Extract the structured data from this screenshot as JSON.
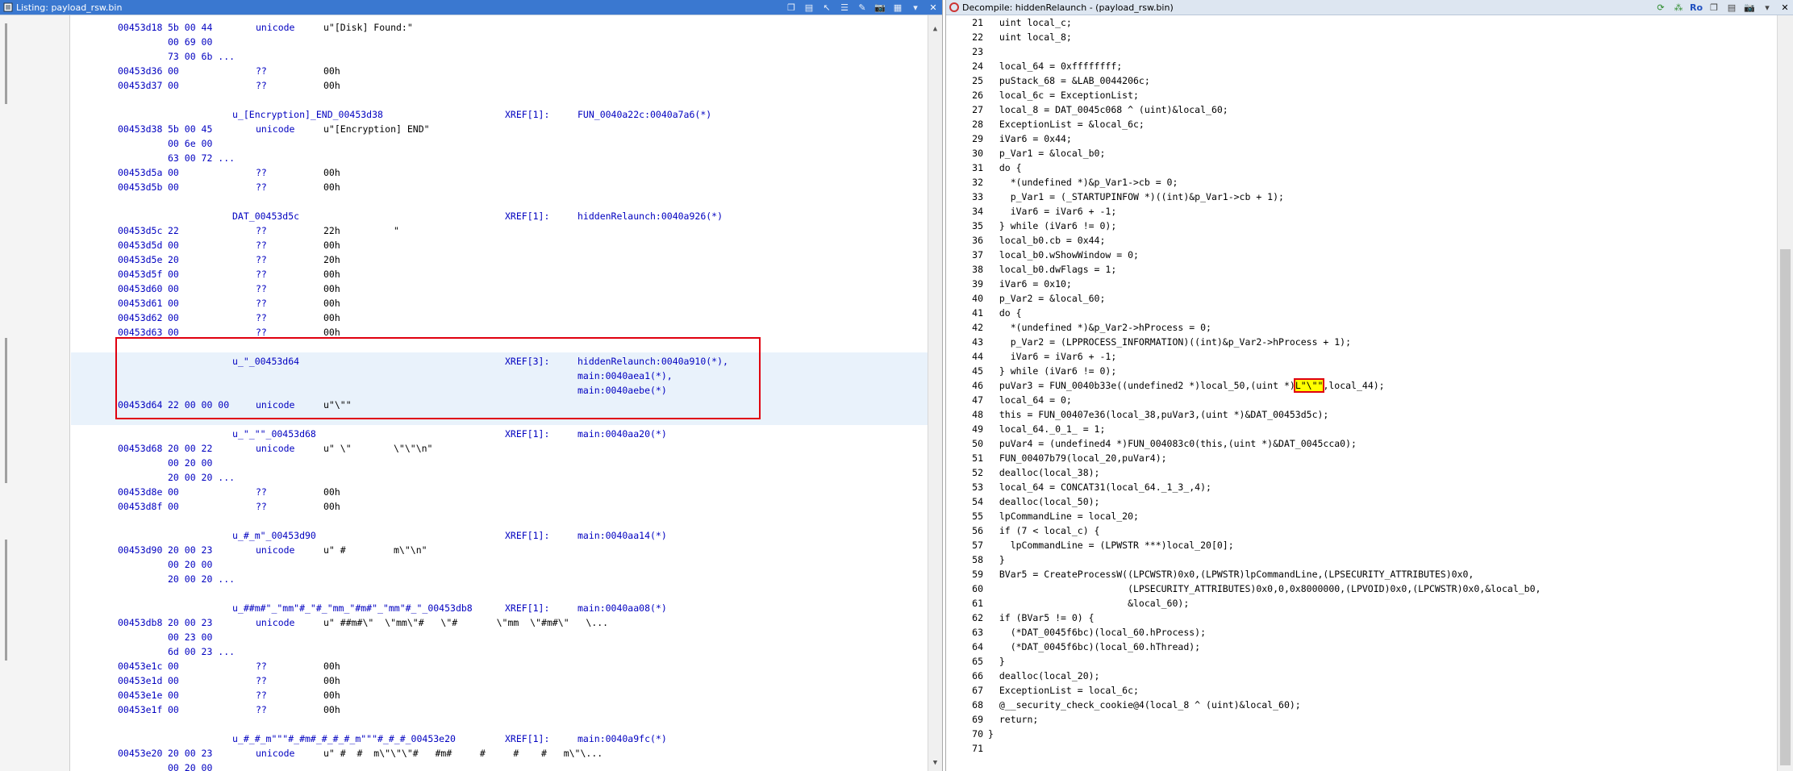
{
  "left": {
    "title": "Listing:  payload_rsw.bin",
    "rows": [
      {
        "type": "data",
        "addr": "00453d18",
        "bytes": "5b 00 44",
        "mnem": "unicode",
        "oper": "u\"[Disk] Found:\""
      },
      {
        "type": "cont",
        "bytes": "00 69 00"
      },
      {
        "type": "cont",
        "bytes": "73 00 6b ..."
      },
      {
        "type": "data",
        "addr": "00453d36",
        "bytes": "00",
        "mnem": "??",
        "oper": "00h"
      },
      {
        "type": "data",
        "addr": "00453d37",
        "bytes": "00",
        "mnem": "??",
        "oper": "00h"
      },
      {
        "type": "blank"
      },
      {
        "type": "label",
        "label": "u_[Encryption]_END_00453d38",
        "xref": "XREF[1]:",
        "xref_t": "FUN_0040a22c:0040a7a6(*)"
      },
      {
        "type": "data",
        "addr": "00453d38",
        "bytes": "5b 00 45",
        "mnem": "unicode",
        "oper": "u\"[Encryption] END\""
      },
      {
        "type": "cont",
        "bytes": "00 6e 00"
      },
      {
        "type": "cont",
        "bytes": "63 00 72 ..."
      },
      {
        "type": "data",
        "addr": "00453d5a",
        "bytes": "00",
        "mnem": "??",
        "oper": "00h"
      },
      {
        "type": "data",
        "addr": "00453d5b",
        "bytes": "00",
        "mnem": "??",
        "oper": "00h"
      },
      {
        "type": "blank"
      },
      {
        "type": "label",
        "label": "DAT_00453d5c",
        "xref": "XREF[1]:",
        "xref_t": "hiddenRelaunch:0040a926(*)"
      },
      {
        "type": "data",
        "addr": "00453d5c",
        "bytes": "22",
        "mnem": "??",
        "oper": "22h",
        "cmt": "\""
      },
      {
        "type": "data",
        "addr": "00453d5d",
        "bytes": "00",
        "mnem": "??",
        "oper": "00h"
      },
      {
        "type": "data",
        "addr": "00453d5e",
        "bytes": "20",
        "mnem": "??",
        "oper": "20h"
      },
      {
        "type": "data",
        "addr": "00453d5f",
        "bytes": "00",
        "mnem": "??",
        "oper": "00h"
      },
      {
        "type": "data",
        "addr": "00453d60",
        "bytes": "00",
        "mnem": "??",
        "oper": "00h"
      },
      {
        "type": "data",
        "addr": "00453d61",
        "bytes": "00",
        "mnem": "??",
        "oper": "00h"
      },
      {
        "type": "data",
        "addr": "00453d62",
        "bytes": "00",
        "mnem": "??",
        "oper": "00h"
      },
      {
        "type": "data",
        "addr": "00453d63",
        "bytes": "00",
        "mnem": "??",
        "oper": "00h"
      },
      {
        "type": "blank"
      },
      {
        "type": "label",
        "label": "u_\"_00453d64",
        "xref": "XREF[3]:",
        "xref_t": "hiddenRelaunch:0040a910(*),"
      },
      {
        "type": "xrefcont",
        "xref_t": "main:0040aea1(*),"
      },
      {
        "type": "xrefcont",
        "xref_t": "main:0040aebe(*)"
      },
      {
        "type": "data",
        "addr": "00453d64",
        "bytes": "22 00 00 00",
        "mnem": "unicode",
        "oper": "u\"\\\"\""
      },
      {
        "type": "blank"
      },
      {
        "type": "label",
        "label": "u_\"_\"\"_00453d68",
        "xref": "XREF[1]:",
        "xref_t": "main:0040aa20(*)"
      },
      {
        "type": "data",
        "addr": "00453d68",
        "bytes": "20 00 22",
        "mnem": "unicode",
        "oper": "u\" \\\"",
        "cmt": "\\\"\\\"\\n\""
      },
      {
        "type": "cont",
        "bytes": "00 20 00"
      },
      {
        "type": "cont",
        "bytes": "20 00 20 ..."
      },
      {
        "type": "data",
        "addr": "00453d8e",
        "bytes": "00",
        "mnem": "??",
        "oper": "00h"
      },
      {
        "type": "data",
        "addr": "00453d8f",
        "bytes": "00",
        "mnem": "??",
        "oper": "00h"
      },
      {
        "type": "blank"
      },
      {
        "type": "label",
        "label": "u_#_m\"_00453d90",
        "xref": "XREF[1]:",
        "xref_t": "main:0040aa14(*)"
      },
      {
        "type": "data",
        "addr": "00453d90",
        "bytes": "20 00 23",
        "mnem": "unicode",
        "oper": "u\" #",
        "cmt": "m\\\"\\n\""
      },
      {
        "type": "cont",
        "bytes": "00 20 00"
      },
      {
        "type": "cont",
        "bytes": "20 00 20 ..."
      },
      {
        "type": "blank"
      },
      {
        "type": "label",
        "label": "u_##m#\"_\"mm\"#_\"#_\"mm_\"#m#\"_\"mm\"#_\"_00453db8",
        "xref": "XREF[1]:",
        "xref_t": "main:0040aa08(*)"
      },
      {
        "type": "data",
        "addr": "00453db8",
        "bytes": "20 00 23",
        "mnem": "unicode",
        "oper": "u\" ##m#\\\"  \\\"mm\\\"#   \\\"#       \\\"mm  \\\"#m#\\\"   \\..."
      },
      {
        "type": "cont",
        "bytes": "00 23 00"
      },
      {
        "type": "cont",
        "bytes": "6d 00 23 ..."
      },
      {
        "type": "data",
        "addr": "00453e1c",
        "bytes": "00",
        "mnem": "??",
        "oper": "00h"
      },
      {
        "type": "data",
        "addr": "00453e1d",
        "bytes": "00",
        "mnem": "??",
        "oper": "00h"
      },
      {
        "type": "data",
        "addr": "00453e1e",
        "bytes": "00",
        "mnem": "??",
        "oper": "00h"
      },
      {
        "type": "data",
        "addr": "00453e1f",
        "bytes": "00",
        "mnem": "??",
        "oper": "00h"
      },
      {
        "type": "blank"
      },
      {
        "type": "label",
        "label": "u_#_#_m\"\"\"#_#m#_#_#_#_m\"\"\"#_#_#_00453e20",
        "xref": "XREF[1]:",
        "xref_t": "main:0040a9fc(*)"
      },
      {
        "type": "data",
        "addr": "00453e20",
        "bytes": "20 00 23",
        "mnem": "unicode",
        "oper": "u\" #  #  m\\\"\\\"\\\"#   #m#     #     #    #   m\\\"\\..."
      },
      {
        "type": "cont",
        "bytes": "00 20 00"
      }
    ]
  },
  "right": {
    "title": "Decompile: hiddenRelaunch -  (payload_rsw.bin)",
    "ro_label": "Ro",
    "lines": [
      {
        "n": "21",
        "code": "  uint local_c;"
      },
      {
        "n": "22",
        "code": "  uint local_8;"
      },
      {
        "n": "23",
        "code": ""
      },
      {
        "n": "24",
        "code": "  local_64 = 0xffffffff;"
      },
      {
        "n": "25",
        "code": "  puStack_68 = &LAB_0044206c;"
      },
      {
        "n": "26",
        "code": "  local_6c = ExceptionList;"
      },
      {
        "n": "27",
        "code": "  local_8 = DAT_0045c068 ^ (uint)&local_60;"
      },
      {
        "n": "28",
        "code": "  ExceptionList = &local_6c;"
      },
      {
        "n": "29",
        "code": "  iVar6 = 0x44;"
      },
      {
        "n": "30",
        "code": "  p_Var1 = &local_b0;"
      },
      {
        "n": "31",
        "code": "  do {"
      },
      {
        "n": "32",
        "code": "    *(undefined *)&p_Var1->cb = 0;"
      },
      {
        "n": "33",
        "code": "    p_Var1 = (_STARTUPINFOW *)((int)&p_Var1->cb + 1);"
      },
      {
        "n": "34",
        "code": "    iVar6 = iVar6 + -1;"
      },
      {
        "n": "35",
        "code": "  } while (iVar6 != 0);"
      },
      {
        "n": "36",
        "code": "  local_b0.cb = 0x44;"
      },
      {
        "n": "37",
        "code": "  local_b0.wShowWindow = 0;"
      },
      {
        "n": "38",
        "code": "  local_b0.dwFlags = 1;"
      },
      {
        "n": "39",
        "code": "  iVar6 = 0x10;"
      },
      {
        "n": "40",
        "code": "  p_Var2 = &local_60;"
      },
      {
        "n": "41",
        "code": "  do {"
      },
      {
        "n": "42",
        "code": "    *(undefined *)&p_Var2->hProcess = 0;"
      },
      {
        "n": "43",
        "code": "    p_Var2 = (LPPROCESS_INFORMATION)((int)&p_Var2->hProcess + 1);"
      },
      {
        "n": "44",
        "code": "    iVar6 = iVar6 + -1;"
      },
      {
        "n": "45",
        "code": "  } while (iVar6 != 0);"
      },
      {
        "n": "46",
        "code": "  puVar3 = FUN_0040b33e((undefined2 *)local_50,(uint *)",
        "hl": "L\"\\\"\"",
        "tail": ",local_44);"
      },
      {
        "n": "47",
        "code": "  local_64 = 0;"
      },
      {
        "n": "48",
        "code": "  this = FUN_00407e36(local_38,puVar3,(uint *)&DAT_00453d5c);"
      },
      {
        "n": "49",
        "code": "  local_64._0_1_ = 1;"
      },
      {
        "n": "50",
        "code": "  puVar4 = (undefined4 *)FUN_004083c0(this,(uint *)&DAT_0045cca0);"
      },
      {
        "n": "51",
        "code": "  FUN_00407b79(local_20,puVar4);"
      },
      {
        "n": "52",
        "code": "  dealloc(local_38);"
      },
      {
        "n": "53",
        "code": "  local_64 = CONCAT31(local_64._1_3_,4);"
      },
      {
        "n": "54",
        "code": "  dealloc(local_50);"
      },
      {
        "n": "55",
        "code": "  lpCommandLine = local_20;"
      },
      {
        "n": "56",
        "code": "  if (7 < local_c) {"
      },
      {
        "n": "57",
        "code": "    lpCommandLine = (LPWSTR ***)local_20[0];"
      },
      {
        "n": "58",
        "code": "  }"
      },
      {
        "n": "59",
        "code": "  BVar5 = CreateProcessW((LPCWSTR)0x0,(LPWSTR)lpCommandLine,(LPSECURITY_ATTRIBUTES)0x0,"
      },
      {
        "n": "60",
        "code": "                         (LPSECURITY_ATTRIBUTES)0x0,0,0x8000000,(LPVOID)0x0,(LPCWSTR)0x0,&local_b0,"
      },
      {
        "n": "61",
        "code": "                         &local_60);"
      },
      {
        "n": "62",
        "code": "  if (BVar5 != 0) {"
      },
      {
        "n": "63",
        "code": "    (*DAT_0045f6bc)(local_60.hProcess);"
      },
      {
        "n": "64",
        "code": "    (*DAT_0045f6bc)(local_60.hThread);"
      },
      {
        "n": "65",
        "code": "  }"
      },
      {
        "n": "66",
        "code": "  dealloc(local_20);"
      },
      {
        "n": "67",
        "code": "  ExceptionList = local_6c;"
      },
      {
        "n": "68",
        "code": "  @__security_check_cookie@4(local_8 ^ (uint)&local_60);"
      },
      {
        "n": "69",
        "code": "  return;"
      },
      {
        "n": "70",
        "code": "}"
      },
      {
        "n": "71",
        "code": ""
      }
    ]
  },
  "colors": {
    "titlebar_active": "#3a78d0",
    "address_blue": "#0000c0",
    "highlight_yellow": "#ffff00",
    "annotation_red": "#e0000f"
  }
}
